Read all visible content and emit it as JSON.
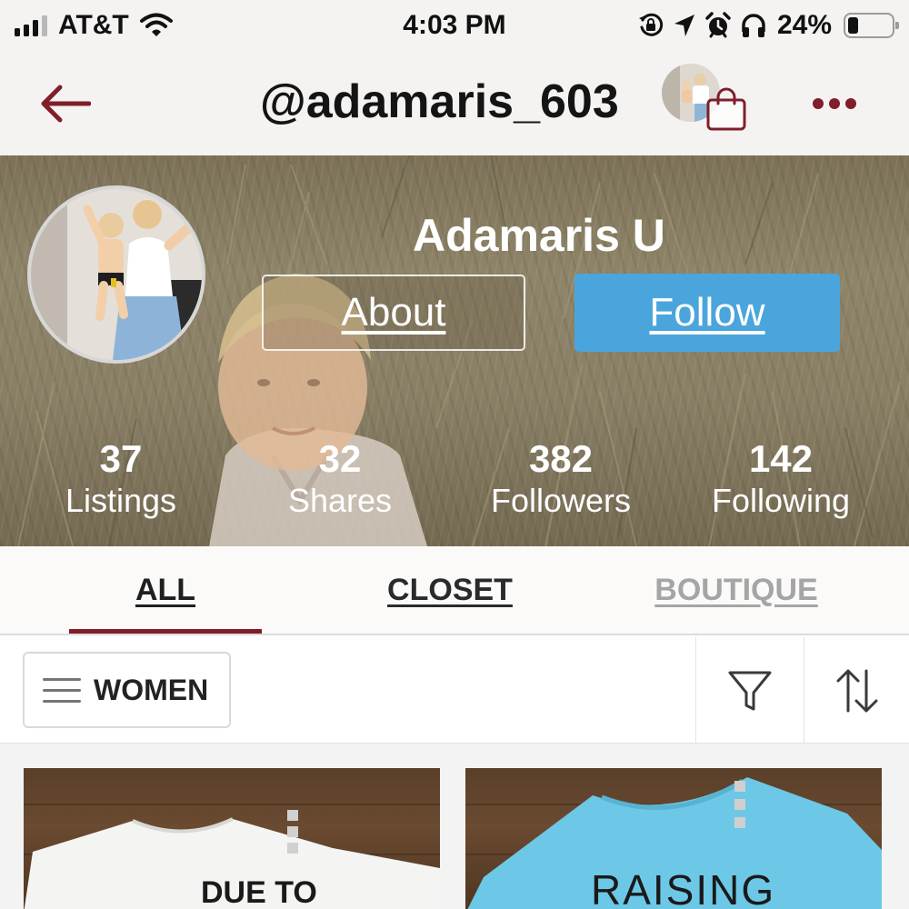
{
  "status_bar": {
    "carrier": "AT&T",
    "time": "4:03 PM",
    "battery_percent": "24%",
    "battery_level": 0.24,
    "icons": [
      "cellular-signal-icon",
      "wifi-icon",
      "orientation-lock-icon",
      "location-arrow-icon",
      "alarm-icon",
      "headphones-icon",
      "battery-icon"
    ]
  },
  "nav": {
    "title": "@adamaris_603",
    "icons": [
      "back-arrow-icon",
      "shopping-bag-icon",
      "more-dots-icon"
    ],
    "accent_color": "#7f1f2b"
  },
  "profile": {
    "display_name": "Adamaris U",
    "about_label": "About",
    "follow_label": "Follow",
    "follow_color": "#4aa5dc",
    "stats": [
      {
        "value": "37",
        "label": "Listings"
      },
      {
        "value": "32",
        "label": "Shares"
      },
      {
        "value": "382",
        "label": "Followers"
      },
      {
        "value": "142",
        "label": "Following"
      }
    ]
  },
  "tabs": [
    {
      "label": "ALL",
      "active": true
    },
    {
      "label": "CLOSET",
      "active": false
    },
    {
      "label": "BOUTIQUE",
      "active": false
    }
  ],
  "filter_bar": {
    "department": "WOMEN",
    "icons": [
      "hamburger-menu-icon",
      "filter-funnel-icon",
      "sort-arrows-icon"
    ]
  },
  "listings": [
    {
      "shirt_text": "DUE TO",
      "shirt_color": "#f4f4f2"
    },
    {
      "shirt_text": "RAISING",
      "shirt_color": "#6cc8e6"
    }
  ]
}
